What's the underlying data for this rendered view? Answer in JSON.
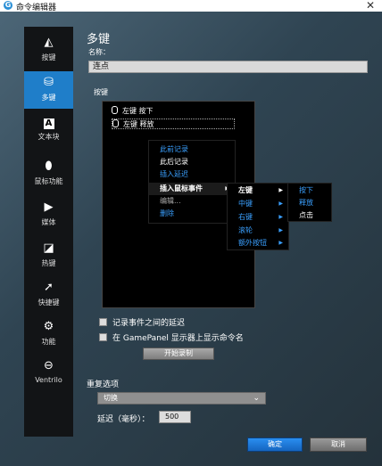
{
  "window": {
    "title": "命令编辑器",
    "close": "✕"
  },
  "sidebar": {
    "items": [
      {
        "name": "sidebar-item-keys",
        "label": "按键",
        "icon": "keycap-icon",
        "glyph": "◭"
      },
      {
        "name": "sidebar-item-multikey",
        "label": "多键",
        "icon": "multikey-icon",
        "glyph": "⛁"
      },
      {
        "name": "sidebar-item-textblock",
        "label": "文本块",
        "icon": "letter-a-icon",
        "glyph": "A"
      },
      {
        "name": "sidebar-item-mouse",
        "label": "鼠标功能",
        "icon": "mouse-icon",
        "glyph": "⬮"
      },
      {
        "name": "sidebar-item-media",
        "label": "媒体",
        "icon": "play-icon",
        "glyph": "▶"
      },
      {
        "name": "sidebar-item-hotkey",
        "label": "热键",
        "icon": "hotkey-icon",
        "glyph": "◪"
      },
      {
        "name": "sidebar-item-shortcut",
        "label": "快捷键",
        "icon": "arrow-icon",
        "glyph": "➚"
      },
      {
        "name": "sidebar-item-function",
        "label": "功能",
        "icon": "gear-icon",
        "glyph": "⚙"
      },
      {
        "name": "sidebar-item-ventrilo",
        "label": "Ventrilo",
        "icon": "headset-icon",
        "glyph": "⊖"
      }
    ],
    "active_index": 1
  },
  "main": {
    "title": "多键",
    "name_label": "名称：",
    "name_value": "连点",
    "keys_label": "按键",
    "key_rows": [
      {
        "text": "左键 按下"
      },
      {
        "text": "左键 释放"
      }
    ]
  },
  "context_menu": {
    "items": [
      "此前记录",
      "此后记录",
      "插入延迟",
      "插入鼠标事件",
      "编辑...",
      "删除"
    ]
  },
  "submenu_buttons": {
    "items": [
      "左键",
      "中键",
      "右键",
      "滚轮",
      "额外按钮"
    ]
  },
  "submenu_actions": {
    "items": [
      "按下",
      "释放",
      "点击"
    ]
  },
  "options": {
    "record_delays": "记录事件之间的延迟",
    "show_gamepanel": "在 GamePanel 显示器上显示命令名",
    "record_button": "开始录制"
  },
  "repeat": {
    "label": "重复选项",
    "selected": "切换",
    "delay_label": "延迟（毫秒）：",
    "delay_value": "500"
  },
  "footer": {
    "ok": "确定",
    "cancel": "取消"
  },
  "colors": {
    "accent": "#1f7ec9",
    "menu_blue": "#3aa0ff"
  }
}
